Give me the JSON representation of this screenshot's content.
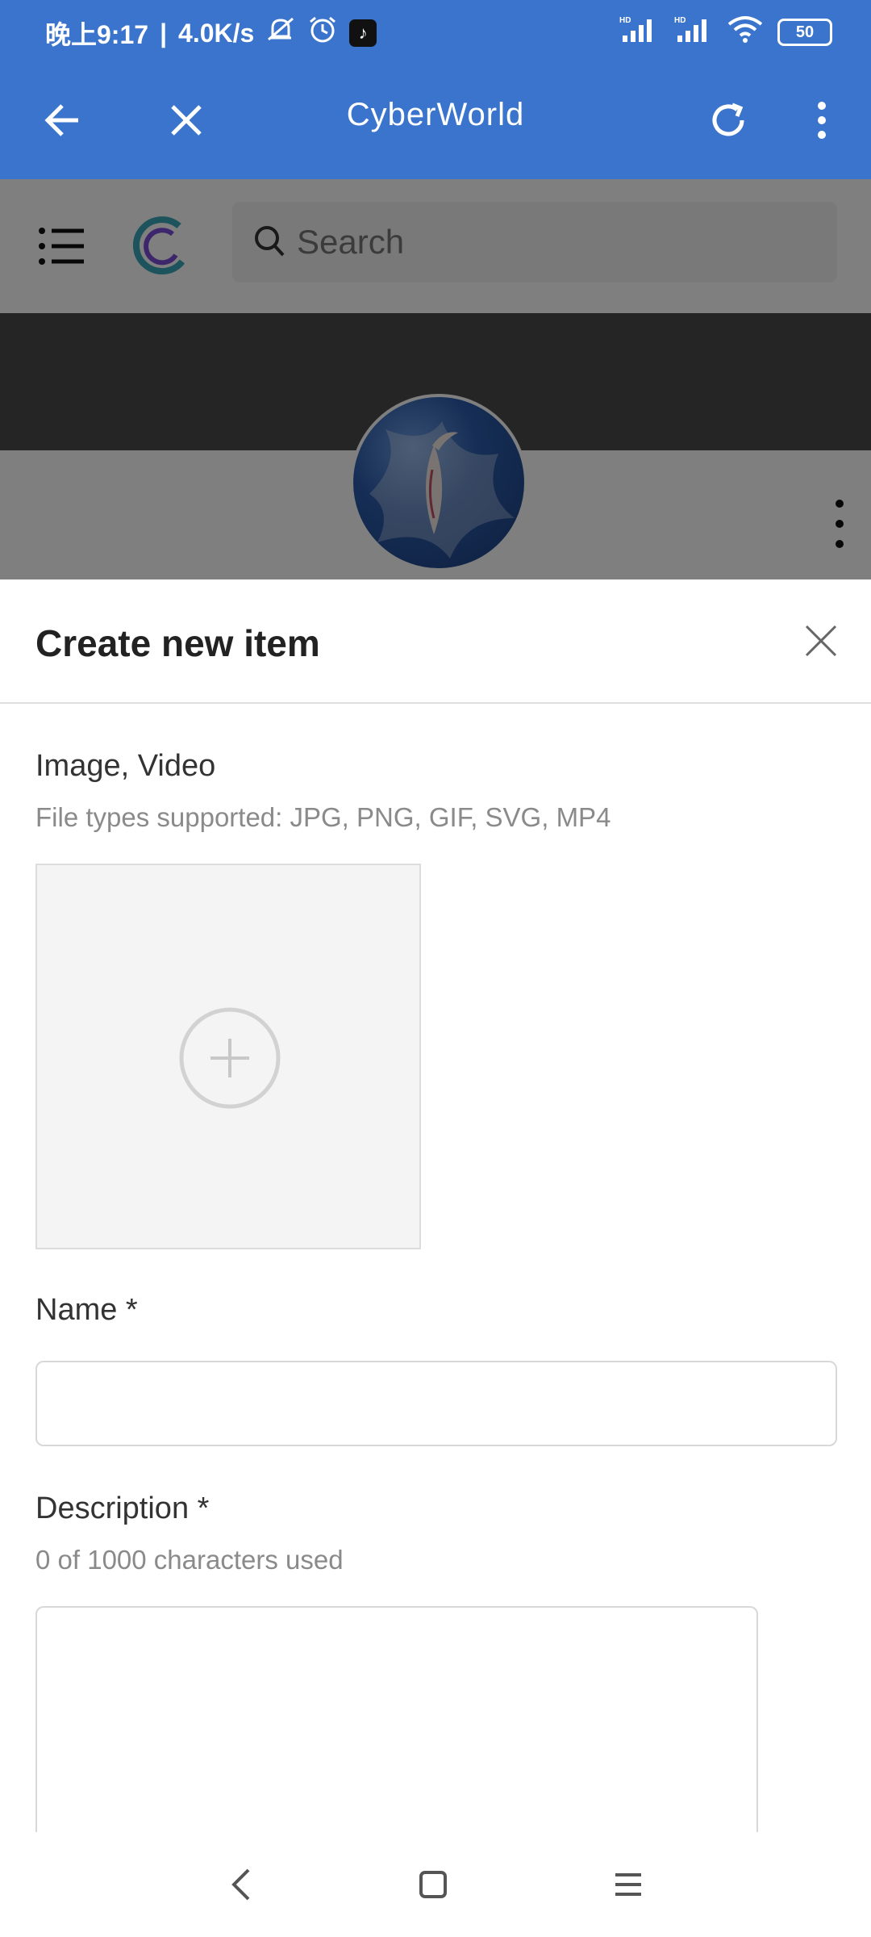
{
  "status_bar": {
    "time": "晚上9:17",
    "separator": "|",
    "network_speed": "4.0K/s",
    "battery_level": "50",
    "icons": [
      "mute-icon",
      "alarm-icon",
      "tiktok-icon",
      "signal-hd-icon",
      "signal-hd-icon",
      "wifi-icon",
      "battery-icon"
    ]
  },
  "app_bar": {
    "title": "CyberWorld",
    "color": "#3a74cc",
    "icons": [
      "back-arrow-icon",
      "close-icon",
      "refresh-icon",
      "more-vertical-icon"
    ]
  },
  "web_page": {
    "search": {
      "placeholder": "Search"
    },
    "icons": [
      "hamburger-menu-icon",
      "site-logo",
      "search-icon",
      "more-vertical-icon"
    ]
  },
  "sheet": {
    "title": "Create new item",
    "media": {
      "label": "Image, Video",
      "hint": "File types supported: JPG, PNG, GIF, SVG, MP4"
    },
    "name": {
      "label": "Name *",
      "value": ""
    },
    "description": {
      "label": "Description *",
      "counter": "0 of 1000 characters used",
      "value": ""
    }
  },
  "nav_bar": {
    "icons": [
      "nav-back-icon",
      "nav-home-icon",
      "nav-recents-icon"
    ]
  }
}
